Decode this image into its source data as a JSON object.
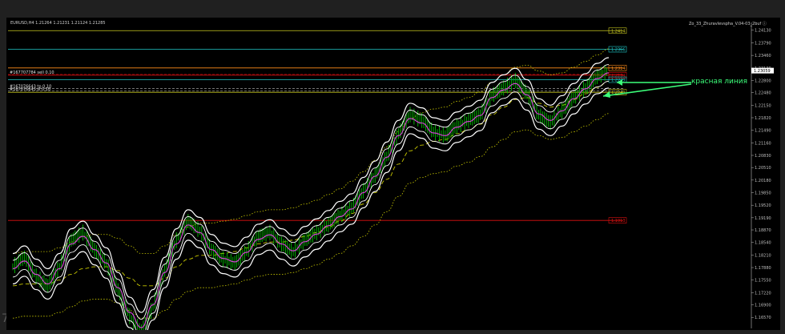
{
  "window": {
    "symbol_line": "EURUSD,H4  1.21264 1.21231 1.21124 1.21285",
    "indicator_name": "Zo_33_Zhuravlevspha_V.04-03_2buf"
  },
  "colors": {
    "background": "#000000",
    "price_candles": "#00c000",
    "fast_ma": "#e040e0",
    "envelope": "#ffffff",
    "slow_ma_dashed": "#c8c800",
    "red_level": "#e01010",
    "cyan_level": "#20c8c8",
    "yellow_level": "#c8c820",
    "annotation": "#3cff7a"
  },
  "chart_data": {
    "type": "line",
    "instrument": "EURUSD",
    "timeframe": "H4",
    "ylim": [
      1.1628,
      1.242
    ],
    "y_ticks": [
      "1.24130",
      "1.23790",
      "1.23460",
      "1.23130",
      "1.22800",
      "1.22480",
      "1.22150",
      "1.21820",
      "1.21490",
      "1.21160",
      "1.20830",
      "1.20510",
      "1.20180",
      "1.19850",
      "1.19520",
      "1.19190",
      "1.18870",
      "1.18540",
      "1.18210",
      "1.17880",
      "1.17550",
      "1.17220",
      "1.16900",
      "1.16570"
    ],
    "last_price": "1.23059",
    "horizontal_levels": [
      {
        "label": "1.2414",
        "value": 1.2411,
        "color": "yellow"
      },
      {
        "label": "1.2366",
        "value": 1.2362,
        "color": "cyan"
      },
      {
        "label": "1.2314",
        "value": 1.2313,
        "color": "orange"
      },
      {
        "label": "1.2294",
        "value": 1.2294,
        "color": "red"
      },
      {
        "label": "1.2279",
        "value": 1.2282,
        "color": "cyan"
      },
      {
        "label": "1.2249",
        "value": 1.2249,
        "color": "yellow"
      },
      {
        "label": "1.1913",
        "value": 1.1912,
        "color": "red"
      }
    ],
    "left_labels": [
      {
        "text": "#167707784 sell 0.10",
        "value": 1.2296
      },
      {
        "text": "#167076643 tp 0.10",
        "value": 1.2259
      },
      {
        "text": "#167076643 sl 0.10",
        "value": 1.2252
      }
    ],
    "price_series": [
      1.179,
      1.1815,
      1.1765,
      1.174,
      1.179,
      1.186,
      1.188,
      1.1835,
      1.18,
      1.173,
      1.166,
      1.162,
      1.1685,
      1.178,
      1.186,
      1.191,
      1.1885,
      1.1835,
      1.181,
      1.18,
      1.183,
      1.187,
      1.188,
      1.185,
      1.183,
      1.186,
      1.188,
      1.19,
      1.1925,
      1.1945,
      1.199,
      1.203,
      1.208,
      1.214,
      1.219,
      1.2175,
      1.2145,
      1.2135,
      1.216,
      1.2175,
      1.219,
      1.224,
      1.226,
      1.228,
      1.2245,
      1.219,
      1.217,
      1.22,
      1.2235,
      1.226,
      1.229,
      1.2305
    ],
    "fast_ma": [
      1.1785,
      1.1805,
      1.177,
      1.1745,
      1.1785,
      1.185,
      1.187,
      1.1835,
      1.18,
      1.1735,
      1.167,
      1.163,
      1.169,
      1.1775,
      1.185,
      1.19,
      1.188,
      1.1835,
      1.1812,
      1.1803,
      1.1828,
      1.1862,
      1.1874,
      1.185,
      1.1832,
      1.1856,
      1.1876,
      1.1898,
      1.1922,
      1.1942,
      1.1985,
      1.2028,
      1.2078,
      1.2135,
      1.218,
      1.2168,
      1.2142,
      1.2135,
      1.2157,
      1.2172,
      1.2188,
      1.2235,
      1.2255,
      1.2272,
      1.2242,
      1.2192,
      1.2175,
      1.22,
      1.2232,
      1.2258,
      1.2285,
      1.23
    ],
    "envelope_offset": 0.004,
    "slow_ma_dashed": [
      1.174,
      1.1745,
      1.1745,
      1.1745,
      1.1755,
      1.177,
      1.1785,
      1.179,
      1.179,
      1.178,
      1.176,
      1.174,
      1.174,
      1.176,
      1.179,
      1.181,
      1.182,
      1.182,
      1.1825,
      1.183,
      1.184,
      1.185,
      1.1855,
      1.1855,
      1.186,
      1.187,
      1.188,
      1.1895,
      1.191,
      1.193,
      1.1955,
      1.1985,
      1.202,
      1.206,
      1.2095,
      1.211,
      1.212,
      1.2125,
      1.214,
      1.215,
      1.2165,
      1.219,
      1.221,
      1.223,
      1.2235,
      1.222,
      1.221,
      1.2215,
      1.223,
      1.2245,
      1.2262,
      1.2278
    ],
    "slow_band_offset": 0.0085
  },
  "annotation": {
    "text": "красная линия"
  }
}
